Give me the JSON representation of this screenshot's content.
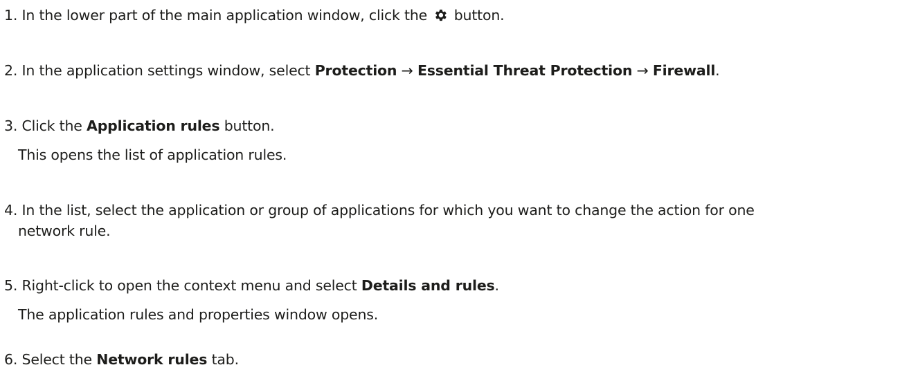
{
  "steps": [
    {
      "number": "1.",
      "before": "In the lower part of the main application window, click the",
      "icon": "gear-icon",
      "after": "button."
    },
    {
      "number": "2.",
      "before": "In the application settings window, select",
      "b1": "Protection",
      "arrow1": "→",
      "b2": "Essential Threat Protection",
      "arrow2": "→",
      "b3": "Firewall",
      "after": "."
    },
    {
      "number": "3.",
      "before": "Click the",
      "b1": "Application rules",
      "after": "button.",
      "note": "This opens the list of application rules."
    },
    {
      "number": "4.",
      "line1": "In the list, select the application or group of applications for which you want to change the action for one",
      "line2": "network rule."
    },
    {
      "number": "5.",
      "before": "Right-click to open the context menu and select",
      "b1": "Details and rules",
      "after": ".",
      "note": "The application rules and properties window opens."
    },
    {
      "number": "6.",
      "before": "Select the",
      "b1": "Network rules",
      "after": "tab."
    }
  ]
}
